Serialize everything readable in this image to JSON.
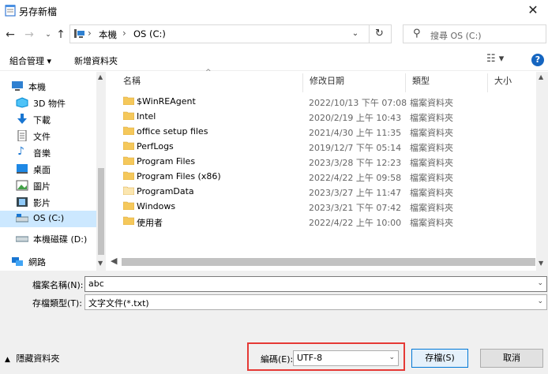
{
  "window": {
    "title": "另存新檔"
  },
  "address": {
    "crumbs": [
      "本機",
      "OS (C:)"
    ]
  },
  "search": {
    "placeholder": "搜尋 OS (C:)"
  },
  "toolbar": {
    "organize": "組合管理",
    "new_folder": "新增資料夾"
  },
  "nav": {
    "items": [
      {
        "label": "本機",
        "icon": "pc-icon"
      },
      {
        "label": "3D 物件",
        "icon": "3d-objects-icon"
      },
      {
        "label": "下載",
        "icon": "download-icon"
      },
      {
        "label": "文件",
        "icon": "documents-icon"
      },
      {
        "label": "音樂",
        "icon": "music-icon"
      },
      {
        "label": "桌面",
        "icon": "desktop-icon"
      },
      {
        "label": "圖片",
        "icon": "pictures-icon"
      },
      {
        "label": "影片",
        "icon": "videos-icon"
      },
      {
        "label": "OS (C:)",
        "icon": "drive-icon"
      },
      {
        "label": "本機磁碟 (D:)",
        "icon": "drive-icon"
      },
      {
        "label": "網路",
        "icon": "network-icon"
      }
    ]
  },
  "columns": {
    "name": "名稱",
    "date": "修改日期",
    "type": "類型",
    "size": "大小"
  },
  "files": [
    {
      "name": "$WinREAgent",
      "date": "2022/10/13 下午 07:08",
      "type": "檔案資料夾"
    },
    {
      "name": "Intel",
      "date": "2020/2/19 上午 10:43",
      "type": "檔案資料夾"
    },
    {
      "name": "office setup files",
      "date": "2021/4/30 上午 11:35",
      "type": "檔案資料夾"
    },
    {
      "name": "PerfLogs",
      "date": "2019/12/7 下午 05:14",
      "type": "檔案資料夾"
    },
    {
      "name": "Program Files",
      "date": "2023/3/28 下午 12:23",
      "type": "檔案資料夾"
    },
    {
      "name": "Program Files (x86)",
      "date": "2022/4/22 上午 09:58",
      "type": "檔案資料夾"
    },
    {
      "name": "ProgramData",
      "date": "2023/3/27 上午 11:47",
      "type": "檔案資料夾"
    },
    {
      "name": "Windows",
      "date": "2023/3/21 下午 07:42",
      "type": "檔案資料夾"
    },
    {
      "name": "使用者",
      "date": "2022/4/22 上午 10:00",
      "type": "檔案資料夾"
    }
  ],
  "form": {
    "filename_label": "檔案名稱(N):",
    "filename_value": "abc",
    "filetype_label": "存檔類型(T):",
    "filetype_value": "文字文件(*.txt)",
    "encoding_label": "編碼(E):",
    "encoding_value": "UTF-8"
  },
  "buttons": {
    "save": "存檔(S)",
    "cancel": "取消",
    "hide_folders": "隱藏資料夾"
  },
  "colors": {
    "accent": "#0078d7",
    "folder": "#f5c85b",
    "highlight": "#e53935",
    "selected": "#cce8ff"
  }
}
